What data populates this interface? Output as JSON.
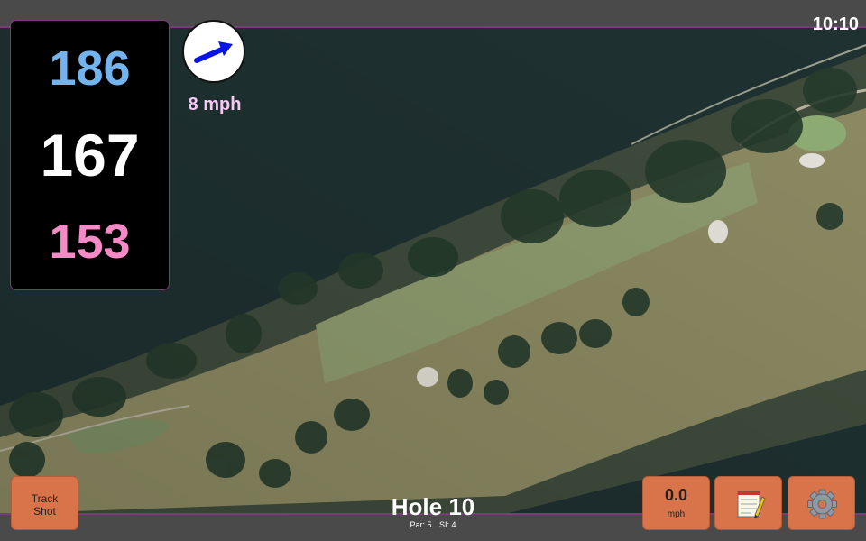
{
  "status_bar": {
    "time": "10:10"
  },
  "distances": {
    "back": "186",
    "center": "167",
    "front": "153"
  },
  "wind": {
    "speed": "8 mph",
    "direction_icon": "arrow-right-up-icon",
    "arrow_color": "#0a14e6"
  },
  "hole": {
    "title": "Hole 10",
    "par": "Par: 5",
    "si": "SI: 4"
  },
  "buttons": {
    "track_shot": [
      "Track",
      "Shot"
    ],
    "speed_value": "0.0",
    "speed_unit": "mph",
    "notes_icon": "notepad-icon",
    "settings_icon": "gear-icon"
  },
  "colors": {
    "back": "#74b4ee",
    "center": "#ffffff",
    "front": "#f48ac6",
    "button": "#d9744a",
    "accent_border": "#7a3b7a"
  }
}
